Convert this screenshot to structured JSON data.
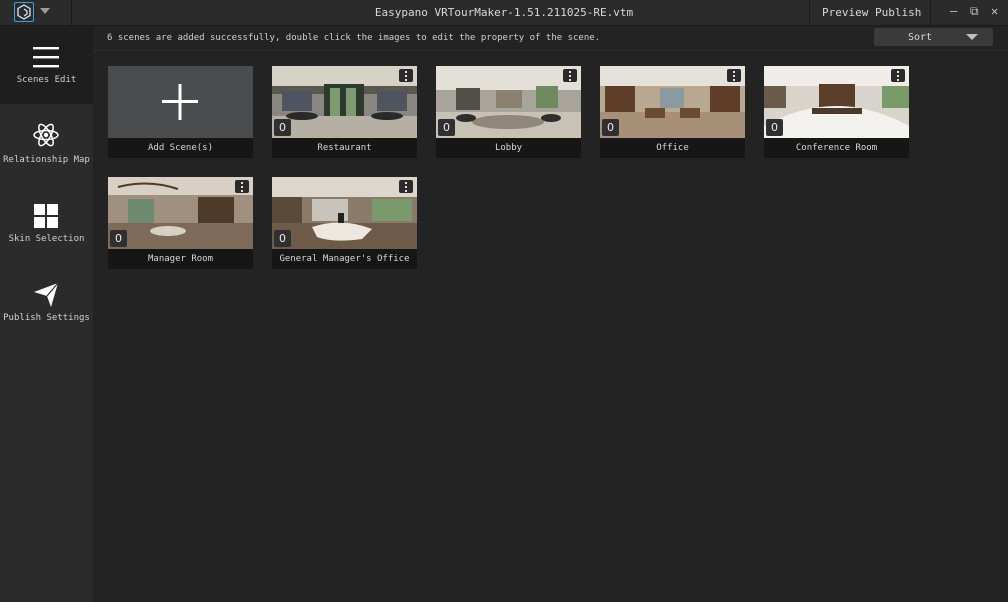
{
  "titlebar": {
    "window_title": "Easypano VRTourMaker-1.51.211025-RE.vtm",
    "preview_label": "Preview",
    "publish_label": "Publish",
    "minimize_symbol": "—",
    "restore_symbol": "⧉",
    "close_symbol": "✕"
  },
  "sidebar": {
    "items": [
      {
        "label": "Scenes Edit",
        "icon": "hamburger-icon",
        "active": true
      },
      {
        "label": "Relationship Map",
        "icon": "atom-icon",
        "active": false
      },
      {
        "label": "Skin Selection",
        "icon": "grid-icon",
        "active": false
      },
      {
        "label": "Publish Settings",
        "icon": "send-icon",
        "active": false
      }
    ]
  },
  "main": {
    "status_text": "6 scenes are added successfully, double click the images to edit the property of the scene.",
    "sort_label": "Sort",
    "add_scene_label": "Add Scene(s)",
    "scenes": [
      {
        "name": "Restaurant",
        "count": "0"
      },
      {
        "name": "Lobby",
        "count": "0"
      },
      {
        "name": "Office",
        "count": "0"
      },
      {
        "name": "Conference Room",
        "count": "0"
      },
      {
        "name": "Manager Room",
        "count": "0"
      },
      {
        "name": "General Manager's Office",
        "count": "0"
      }
    ]
  },
  "colors": {
    "background": "#232323",
    "sidebar": "#2b2b2b",
    "accent": "#3aa0e0"
  }
}
